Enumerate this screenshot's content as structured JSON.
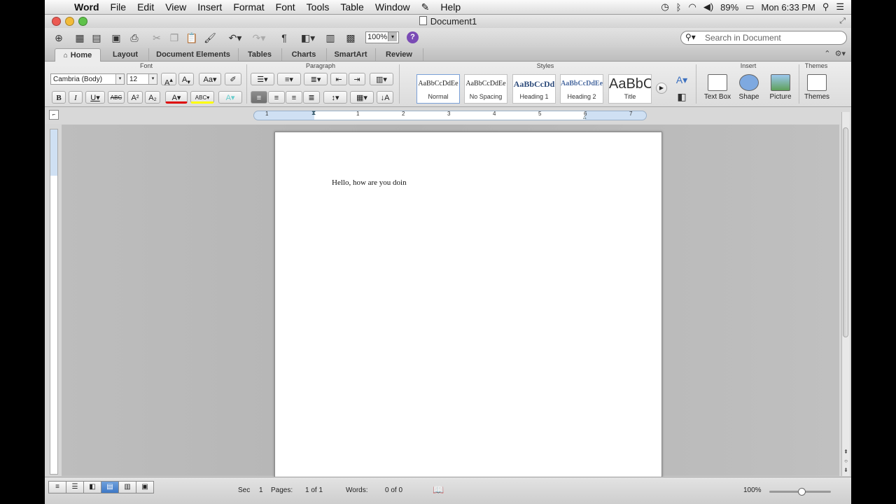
{
  "menubar": {
    "apple": "",
    "items": [
      "Word",
      "File",
      "Edit",
      "View",
      "Insert",
      "Format",
      "Font",
      "Tools",
      "Table",
      "Window",
      "Help"
    ],
    "battery": "89%",
    "clock": "Mon 6:33 PM"
  },
  "window": {
    "title": "Document1"
  },
  "toolbar": {
    "zoom": "100%",
    "search_placeholder": "Search in Document"
  },
  "ribbon_tabs": [
    "Home",
    "Layout",
    "Document Elements",
    "Tables",
    "Charts",
    "SmartArt",
    "Review"
  ],
  "ribbon": {
    "groups": {
      "font": "Font",
      "paragraph": "Paragraph",
      "styles": "Styles",
      "insert": "Insert",
      "themes": "Themes"
    },
    "font_name": "Cambria (Body)",
    "font_size": "12",
    "styles": [
      {
        "preview": "AaBbCcDdEe",
        "name": "Normal"
      },
      {
        "preview": "AaBbCcDdEe",
        "name": "No Spacing"
      },
      {
        "preview": "AaBbCcDd",
        "name": "Heading 1"
      },
      {
        "preview": "AaBbCcDdEe",
        "name": "Heading 2"
      },
      {
        "preview": "AaBbC",
        "name": "Title"
      }
    ],
    "insert": {
      "text_box": "Text Box",
      "shape": "Shape",
      "picture": "Picture"
    },
    "themes": "Themes"
  },
  "ruler": {
    "numbers": [
      "1",
      "1",
      "2",
      "3",
      "4",
      "5",
      "6",
      "7"
    ]
  },
  "document": {
    "text": "Hello, how are you doin"
  },
  "status": {
    "sec_label": "Sec",
    "sec_value": "1",
    "pages_label": "Pages:",
    "pages_value": "1 of 1",
    "words_label": "Words:",
    "words_value": "0 of 0",
    "zoom": "100%"
  }
}
